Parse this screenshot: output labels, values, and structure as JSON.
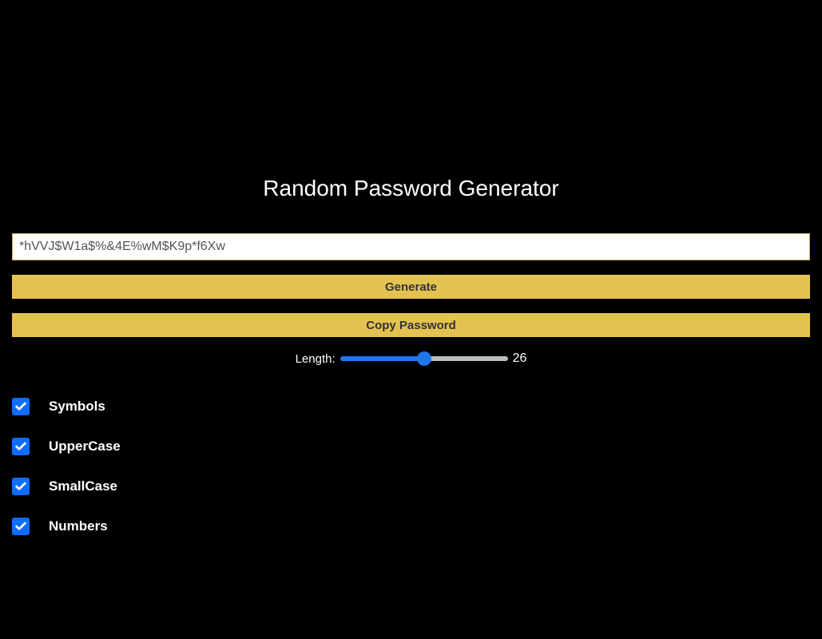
{
  "title": "Random Password Generator",
  "password_value": "*hVVJ$W1a$%&4E%wM$K9p*f6Xw",
  "buttons": {
    "generate": "Generate",
    "copy": "Copy Password"
  },
  "length": {
    "label": "Length:",
    "value": "26"
  },
  "options": [
    {
      "label": "Symbols",
      "checked": true
    },
    {
      "label": "UpperCase",
      "checked": true
    },
    {
      "label": "SmallCase",
      "checked": true
    },
    {
      "label": "Numbers",
      "checked": true
    }
  ]
}
